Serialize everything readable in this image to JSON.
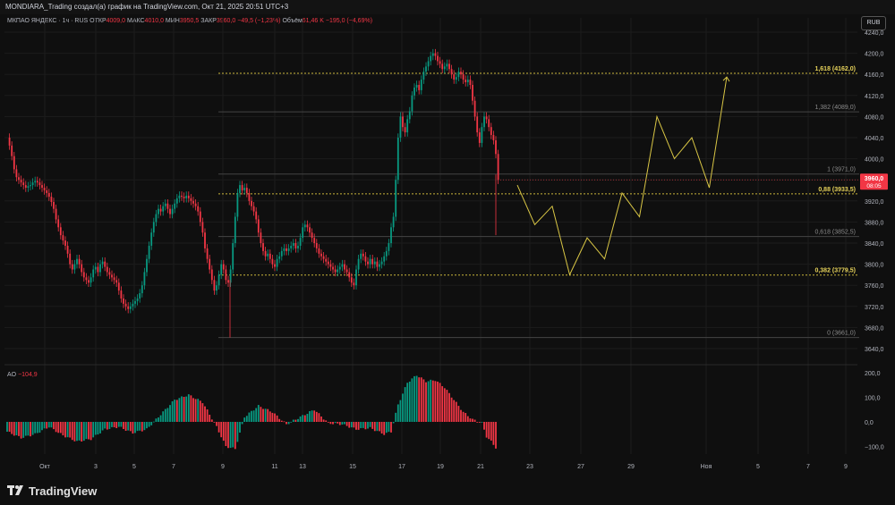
{
  "header": {
    "title": "MONDIARA_Trading создал(а) график на TradingView.com, Окт 21, 2025 20:51 UTC+3"
  },
  "legend": {
    "symbol": "МКПАО ЯНДЕКС · 1ч · RUS",
    "open_label": "ОТКР",
    "open": "4009,0",
    "high_label": "МАКС",
    "high": "4010,0",
    "low_label": "МИН",
    "low": "3950,5",
    "close_label": "ЗАКР",
    "close": "3960,0",
    "change": "−49,5 (−1,23%)",
    "volume_label": "Объём",
    "volume": "61,46 K",
    "volume_change": "−195,0 (−4,69%)"
  },
  "currency_badge": "RUB",
  "indicator": {
    "name": "AO",
    "value": "−104,9"
  },
  "brand": {
    "name": "TradingView"
  },
  "colors": {
    "background": "#0f0f0f",
    "bull": "#089981",
    "bear": "#f23645",
    "forecast": "#d9c645",
    "fib": "#c9b53a",
    "grid": "#1c1c1c"
  },
  "icons": [
    "tradingview-logo-icon"
  ],
  "chart_data": {
    "type": "candlestick",
    "title": "МКПАО ЯНДЕКС · 1ч · RUS",
    "price_axis": {
      "ticks": [
        "4240,0",
        "4200,0",
        "4160,0",
        "4120,0",
        "4080,0",
        "4040,0",
        "4000,0",
        "3960,0",
        "3920,0",
        "3880,0",
        "3840,0",
        "3800,0",
        "3760,0",
        "3720,0",
        "3680,0",
        "3640,0"
      ],
      "tick_values": [
        4240,
        4200,
        4160,
        4120,
        4080,
        4040,
        4000,
        3960,
        3920,
        3880,
        3840,
        3800,
        3760,
        3720,
        3680,
        3640
      ],
      "range": [
        3620,
        4250
      ]
    },
    "time_axis": {
      "ticks": [
        "Окт",
        "3",
        "5",
        "7",
        "9",
        "11",
        "13",
        "15",
        "17",
        "19",
        "21",
        "23",
        "27",
        "29",
        "Ноя",
        "5",
        "7",
        "9"
      ]
    },
    "last_price": {
      "value": 3960.0,
      "label": "3960,0",
      "timer": "08:05"
    },
    "fib_levels": [
      {
        "ratio": "1,618",
        "price": 4162.0,
        "label": "1,618 (4162,0)",
        "highlight": true
      },
      {
        "ratio": "1,382",
        "price": 4089.0,
        "label": "1,382 (4089,0)",
        "highlight": false
      },
      {
        "ratio": "1",
        "price": 3971.0,
        "label": "1 (3971,0)",
        "highlight": false
      },
      {
        "ratio": "0,88",
        "price": 3933.5,
        "label": "0,88 (3933,5)",
        "highlight": true
      },
      {
        "ratio": "0,618",
        "price": 3852.5,
        "label": "0,618 (3852,5)",
        "highlight": false
      },
      {
        "ratio": "0,382",
        "price": 3779.5,
        "label": "0,382 (3779,5)",
        "highlight": true
      },
      {
        "ratio": "0",
        "price": 3661.0,
        "label": "0 (3661,0)",
        "highlight": false
      }
    ],
    "price_path": [
      [
        0,
        4040
      ],
      [
        1,
        4025
      ],
      [
        2,
        4005
      ],
      [
        3,
        3980
      ],
      [
        4,
        3965
      ],
      [
        5,
        3960
      ],
      [
        6,
        3955
      ],
      [
        7,
        3950
      ],
      [
        8,
        3945
      ],
      [
        9,
        3948
      ],
      [
        10,
        3950
      ],
      [
        11,
        3955
      ],
      [
        12,
        3958
      ],
      [
        13,
        3955
      ],
      [
        14,
        3950
      ],
      [
        15,
        3945
      ],
      [
        16,
        3940
      ],
      [
        17,
        3935
      ],
      [
        18,
        3928
      ],
      [
        19,
        3918
      ],
      [
        20,
        3905
      ],
      [
        21,
        3885
      ],
      [
        22,
        3870
      ],
      [
        23,
        3855
      ],
      [
        24,
        3845
      ],
      [
        25,
        3835
      ],
      [
        26,
        3820
      ],
      [
        27,
        3800
      ],
      [
        28,
        3790
      ],
      [
        29,
        3800
      ],
      [
        30,
        3810
      ],
      [
        31,
        3800
      ],
      [
        32,
        3785
      ],
      [
        33,
        3775
      ],
      [
        34,
        3770
      ],
      [
        35,
        3765
      ],
      [
        36,
        3775
      ],
      [
        37,
        3790
      ],
      [
        38,
        3795
      ],
      [
        39,
        3785
      ],
      [
        40,
        3800
      ],
      [
        41,
        3805
      ],
      [
        42,
        3795
      ],
      [
        43,
        3785
      ],
      [
        44,
        3780
      ],
      [
        45,
        3775
      ],
      [
        46,
        3770
      ],
      [
        47,
        3765
      ],
      [
        48,
        3750
      ],
      [
        49,
        3735
      ],
      [
        50,
        3725
      ],
      [
        51,
        3720
      ],
      [
        52,
        3715
      ],
      [
        53,
        3720
      ],
      [
        54,
        3725
      ],
      [
        55,
        3730
      ],
      [
        56,
        3735
      ],
      [
        57,
        3745
      ],
      [
        58,
        3760
      ],
      [
        59,
        3785
      ],
      [
        60,
        3810
      ],
      [
        61,
        3835
      ],
      [
        62,
        3860
      ],
      [
        63,
        3880
      ],
      [
        64,
        3895
      ],
      [
        65,
        3905
      ],
      [
        66,
        3900
      ],
      [
        67,
        3910
      ],
      [
        68,
        3915
      ],
      [
        69,
        3905
      ],
      [
        70,
        3895
      ],
      [
        71,
        3905
      ],
      [
        72,
        3915
      ],
      [
        73,
        3925
      ],
      [
        74,
        3930
      ],
      [
        75,
        3928
      ],
      [
        76,
        3925
      ],
      [
        77,
        3930
      ],
      [
        78,
        3925
      ],
      [
        79,
        3920
      ],
      [
        80,
        3915
      ],
      [
        81,
        3910
      ],
      [
        82,
        3900
      ],
      [
        83,
        3880
      ],
      [
        84,
        3860
      ],
      [
        85,
        3830
      ],
      [
        86,
        3810
      ],
      [
        87,
        3790
      ],
      [
        88,
        3770
      ],
      [
        89,
        3750
      ],
      [
        90,
        3760
      ],
      [
        91,
        3780
      ],
      [
        92,
        3800
      ],
      [
        93,
        3790
      ],
      [
        94,
        3770
      ],
      [
        95,
        3765
      ],
      [
        96,
        3790
      ],
      [
        97,
        3840
      ],
      [
        98,
        3890
      ],
      [
        99,
        3935
      ],
      [
        100,
        3950
      ],
      [
        101,
        3940
      ],
      [
        102,
        3945
      ],
      [
        103,
        3935
      ],
      [
        104,
        3920
      ],
      [
        105,
        3910
      ],
      [
        106,
        3900
      ],
      [
        107,
        3885
      ],
      [
        108,
        3860
      ],
      [
        109,
        3840
      ],
      [
        110,
        3825
      ],
      [
        111,
        3815
      ],
      [
        112,
        3820
      ],
      [
        113,
        3810
      ],
      [
        114,
        3800
      ],
      [
        115,
        3795
      ],
      [
        116,
        3810
      ],
      [
        117,
        3815
      ],
      [
        118,
        3825
      ],
      [
        119,
        3830
      ],
      [
        120,
        3825
      ],
      [
        121,
        3830
      ],
      [
        122,
        3835
      ],
      [
        123,
        3840
      ],
      [
        124,
        3830
      ],
      [
        125,
        3835
      ],
      [
        126,
        3850
      ],
      [
        127,
        3870
      ],
      [
        128,
        3875
      ],
      [
        129,
        3870
      ],
      [
        130,
        3860
      ],
      [
        131,
        3850
      ],
      [
        132,
        3840
      ],
      [
        133,
        3830
      ],
      [
        134,
        3820
      ],
      [
        135,
        3815
      ],
      [
        136,
        3810
      ],
      [
        137,
        3805
      ],
      [
        138,
        3800
      ],
      [
        139,
        3795
      ],
      [
        140,
        3790
      ],
      [
        141,
        3785
      ],
      [
        142,
        3790
      ],
      [
        143,
        3795
      ],
      [
        144,
        3800
      ],
      [
        145,
        3790
      ],
      [
        146,
        3785
      ],
      [
        147,
        3775
      ],
      [
        148,
        3765
      ],
      [
        149,
        3760
      ],
      [
        150,
        3790
      ],
      [
        151,
        3810
      ],
      [
        152,
        3820
      ],
      [
        153,
        3815
      ],
      [
        154,
        3805
      ],
      [
        155,
        3800
      ],
      [
        156,
        3810
      ],
      [
        157,
        3800
      ],
      [
        158,
        3805
      ],
      [
        159,
        3795
      ],
      [
        160,
        3800
      ],
      [
        161,
        3805
      ],
      [
        162,
        3815
      ],
      [
        163,
        3825
      ],
      [
        164,
        3840
      ],
      [
        165,
        3870
      ],
      [
        166,
        3890
      ],
      [
        167,
        3960
      ],
      [
        168,
        4040
      ],
      [
        169,
        4080
      ],
      [
        170,
        4060
      ],
      [
        171,
        4050
      ],
      [
        172,
        4075
      ],
      [
        173,
        4090
      ],
      [
        174,
        4120
      ],
      [
        175,
        4135
      ],
      [
        176,
        4140
      ],
      [
        177,
        4130
      ],
      [
        178,
        4150
      ],
      [
        179,
        4165
      ],
      [
        180,
        4175
      ],
      [
        181,
        4185
      ],
      [
        182,
        4195
      ],
      [
        183,
        4200
      ],
      [
        184,
        4195
      ],
      [
        185,
        4185
      ],
      [
        186,
        4180
      ],
      [
        187,
        4170
      ],
      [
        188,
        4175
      ],
      [
        189,
        4180
      ],
      [
        190,
        4170
      ],
      [
        191,
        4160
      ],
      [
        192,
        4150
      ],
      [
        193,
        4155
      ],
      [
        194,
        4165
      ],
      [
        195,
        4160
      ],
      [
        196,
        4150
      ],
      [
        197,
        4145
      ],
      [
        198,
        4150
      ],
      [
        199,
        4140
      ],
      [
        200,
        4110
      ],
      [
        201,
        4080
      ],
      [
        202,
        4050
      ],
      [
        203,
        4030
      ],
      [
        204,
        4060
      ],
      [
        205,
        4080
      ],
      [
        206,
        4075
      ],
      [
        207,
        4060
      ],
      [
        208,
        4045
      ],
      [
        209,
        4035
      ],
      [
        210,
        4009
      ],
      [
        211,
        3960
      ]
    ],
    "ao_values": [
      [
        0,
        -40
      ],
      [
        6,
        -65
      ],
      [
        12,
        -50
      ],
      [
        18,
        -20
      ],
      [
        24,
        -55
      ],
      [
        30,
        -80
      ],
      [
        36,
        -70
      ],
      [
        42,
        -30
      ],
      [
        48,
        -20
      ],
      [
        54,
        -45
      ],
      [
        60,
        -30
      ],
      [
        66,
        30
      ],
      [
        72,
        90
      ],
      [
        78,
        110
      ],
      [
        84,
        80
      ],
      [
        90,
        -20
      ],
      [
        94,
        -100
      ],
      [
        98,
        -110
      ],
      [
        102,
        20
      ],
      [
        108,
        65
      ],
      [
        114,
        40
      ],
      [
        120,
        -10
      ],
      [
        126,
        20
      ],
      [
        132,
        50
      ],
      [
        138,
        -5
      ],
      [
        144,
        -10
      ],
      [
        150,
        -30
      ],
      [
        156,
        -25
      ],
      [
        162,
        -50
      ],
      [
        165,
        -40
      ],
      [
        168,
        70
      ],
      [
        172,
        160
      ],
      [
        176,
        190
      ],
      [
        180,
        165
      ],
      [
        184,
        170
      ],
      [
        188,
        140
      ],
      [
        192,
        90
      ],
      [
        196,
        40
      ],
      [
        200,
        10
      ],
      [
        204,
        -5
      ],
      [
        206,
        -60
      ],
      [
        208,
        -80
      ],
      [
        210,
        -105
      ]
    ],
    "forecast_path": [
      [
        0,
        3950
      ],
      [
        1,
        3875
      ],
      [
        2,
        3910
      ],
      [
        3,
        3780
      ],
      [
        4,
        3850
      ],
      [
        5,
        3810
      ],
      [
        6,
        3935
      ],
      [
        7,
        3890
      ],
      [
        8,
        4080
      ],
      [
        9,
        4000
      ],
      [
        10,
        4040
      ],
      [
        11,
        3945
      ],
      [
        12,
        4155
      ]
    ]
  }
}
